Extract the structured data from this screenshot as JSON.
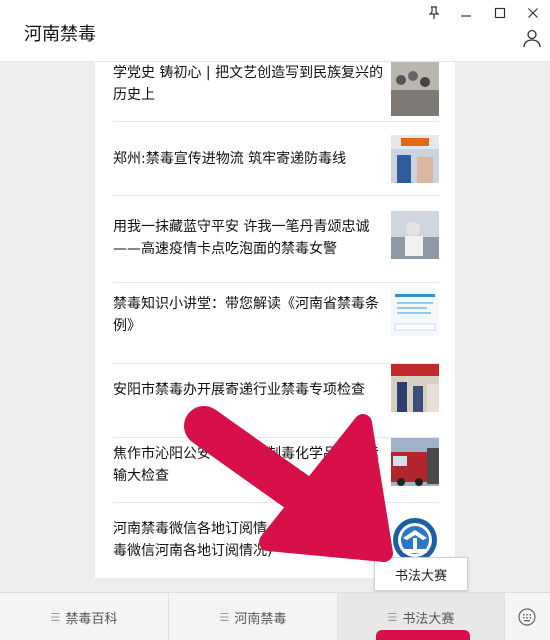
{
  "app": {
    "title": "河南禁毒"
  },
  "window_controls": {
    "pin": "pin-icon",
    "minimize": "minimize-icon",
    "maximize": "maximize-icon",
    "close": "close-icon"
  },
  "articles": [
    {
      "title": "学党史 铸初心 | 把文艺创造写到民族复兴的历史上",
      "thumb": "photo-crowd"
    },
    {
      "title": "郑州:禁毒宣传进物流 筑牢寄递防毒线",
      "thumb": "photo-logistics"
    },
    {
      "title": "用我一抹藏蓝守平安 许我一笔丹青颂忠诚——高速疫情卡点吃泡面的禁毒女警",
      "thumb": "photo-police"
    },
    {
      "title": "禁毒知识小讲堂：带您解读《河南省禁毒条例》",
      "thumb": "doc-thumbnail"
    },
    {
      "title": "安阳市禁毒办开展寄递行业禁毒专项检查",
      "thumb": "photo-inspection"
    },
    {
      "title": "焦作市沁阳公安　　　　制毒化学品安全运输大检查",
      "thumb": "photo-truck"
    },
    {
      "title": "河南禁毒微信各地订阅情　　　　　　　禁毒微信河南各地订阅情况)",
      "thumb": "logo-emblem"
    }
  ],
  "tabs": [
    {
      "label": "禁毒百科",
      "icon": "menu-icon"
    },
    {
      "label": "河南禁毒",
      "icon": "menu-icon"
    },
    {
      "label": "书法大赛",
      "icon": "menu-icon",
      "active": true
    }
  ],
  "popup": {
    "label": "书法大赛"
  },
  "colors": {
    "accent": "#d8104a",
    "annotation_arrow": "#d8104a"
  }
}
